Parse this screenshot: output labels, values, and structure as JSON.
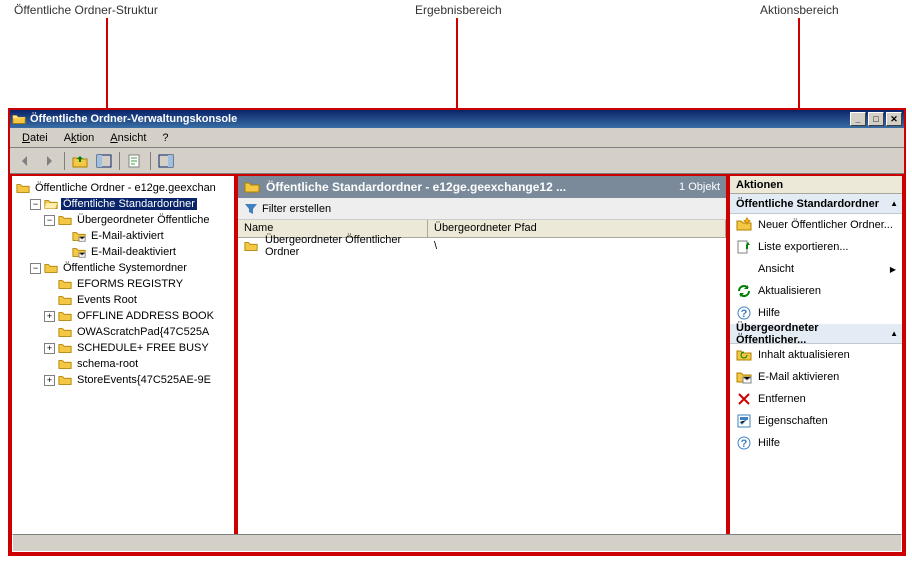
{
  "annotations": {
    "left": "Öffentliche Ordner-Struktur",
    "center": "Ergebnisbereich",
    "right": "Aktionsbereich"
  },
  "window": {
    "title": "Öffentliche Ordner-Verwaltungskonsole"
  },
  "menu": {
    "file": "Datei",
    "action": "Aktion",
    "view": "Ansicht",
    "help": "?"
  },
  "tree": {
    "root": "Öffentliche Ordner - e12ge.geexchan",
    "std": "Öffentliche Standardordner",
    "parent": "Übergeordneter Öffentliche",
    "mail_on": "E-Mail-aktiviert",
    "mail_off": "E-Mail-deaktiviert",
    "sys": "Öffentliche Systemordner",
    "eforms": "EFORMS REGISTRY",
    "events": "Events Root",
    "oab": "OFFLINE ADDRESS BOOK",
    "owa": "OWAScratchPad{47C525A",
    "sched": "SCHEDULE+ FREE BUSY",
    "schema": "schema-root",
    "store": "StoreEvents{47C525AE-9E"
  },
  "results": {
    "header_text": "Öffentliche Standardordner - e12ge.geexchange12 ...",
    "count": "1 Objekt",
    "filter": "Filter erstellen",
    "col_name": "Name",
    "col_path": "Übergeordneter Pfad",
    "row_name": "Übergeordneter Öffentlicher Ordner",
    "row_path": "\\"
  },
  "actions": {
    "title": "Aktionen",
    "section1": "Öffentliche Standardordner",
    "new_folder": "Neuer Öffentlicher Ordner...",
    "export": "Liste exportieren...",
    "view": "Ansicht",
    "refresh": "Aktualisieren",
    "help": "Hilfe",
    "section2": "Übergeordneter Öffentlicher...",
    "update_content": "Inhalt aktualisieren",
    "mail_enable": "E-Mail aktivieren",
    "remove": "Entfernen",
    "properties": "Eigenschaften",
    "help2": "Hilfe"
  }
}
